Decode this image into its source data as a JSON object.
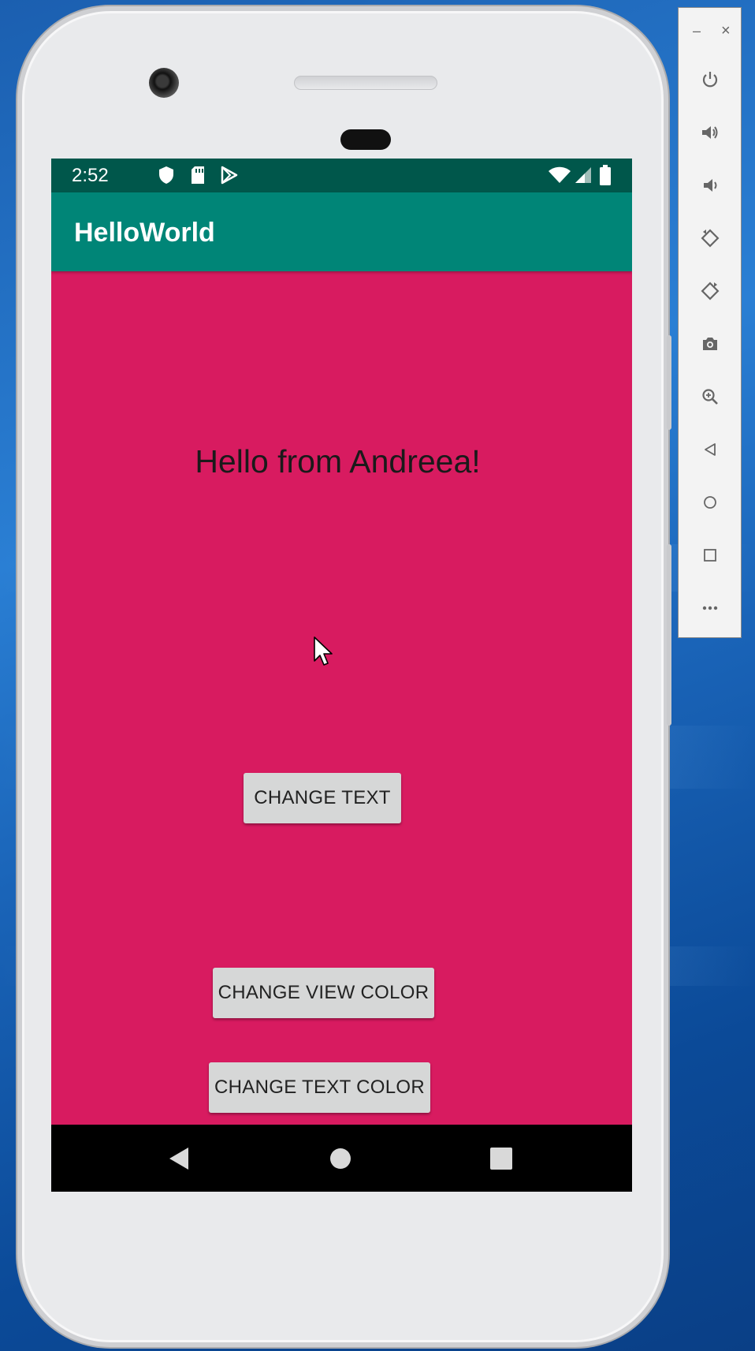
{
  "status_bar": {
    "time": "2:52",
    "left_icons": [
      "shield-icon",
      "sd-card-icon",
      "play-store-icon"
    ],
    "right_icons": [
      "wifi-icon",
      "signal-icon",
      "battery-icon"
    ]
  },
  "app_bar": {
    "title": "HelloWorld"
  },
  "main": {
    "hello_text": "Hello from Andreea!",
    "buttons": {
      "change_text": "CHANGE TEXT",
      "change_view_color": "CHANGE VIEW COLOR",
      "change_text_color": "CHANGE TEXT COLOR"
    }
  },
  "nav_bar": {
    "icons": [
      "back-icon",
      "home-icon",
      "recents-icon"
    ]
  },
  "emulator_toolbar": {
    "window_controls": {
      "minimize": "–",
      "close": "×"
    },
    "tools": [
      "power-icon",
      "volume-up-icon",
      "volume-down-icon",
      "rotate-left-icon",
      "rotate-right-icon",
      "screenshot-icon",
      "zoom-icon",
      "back-icon",
      "home-icon",
      "overview-icon",
      "more-icon"
    ]
  },
  "colors": {
    "status_bar": "#00574b",
    "app_bar": "#008577",
    "view_background": "#d81b60",
    "button": "#d6d7d7",
    "desktop": "#1b6ac2"
  }
}
